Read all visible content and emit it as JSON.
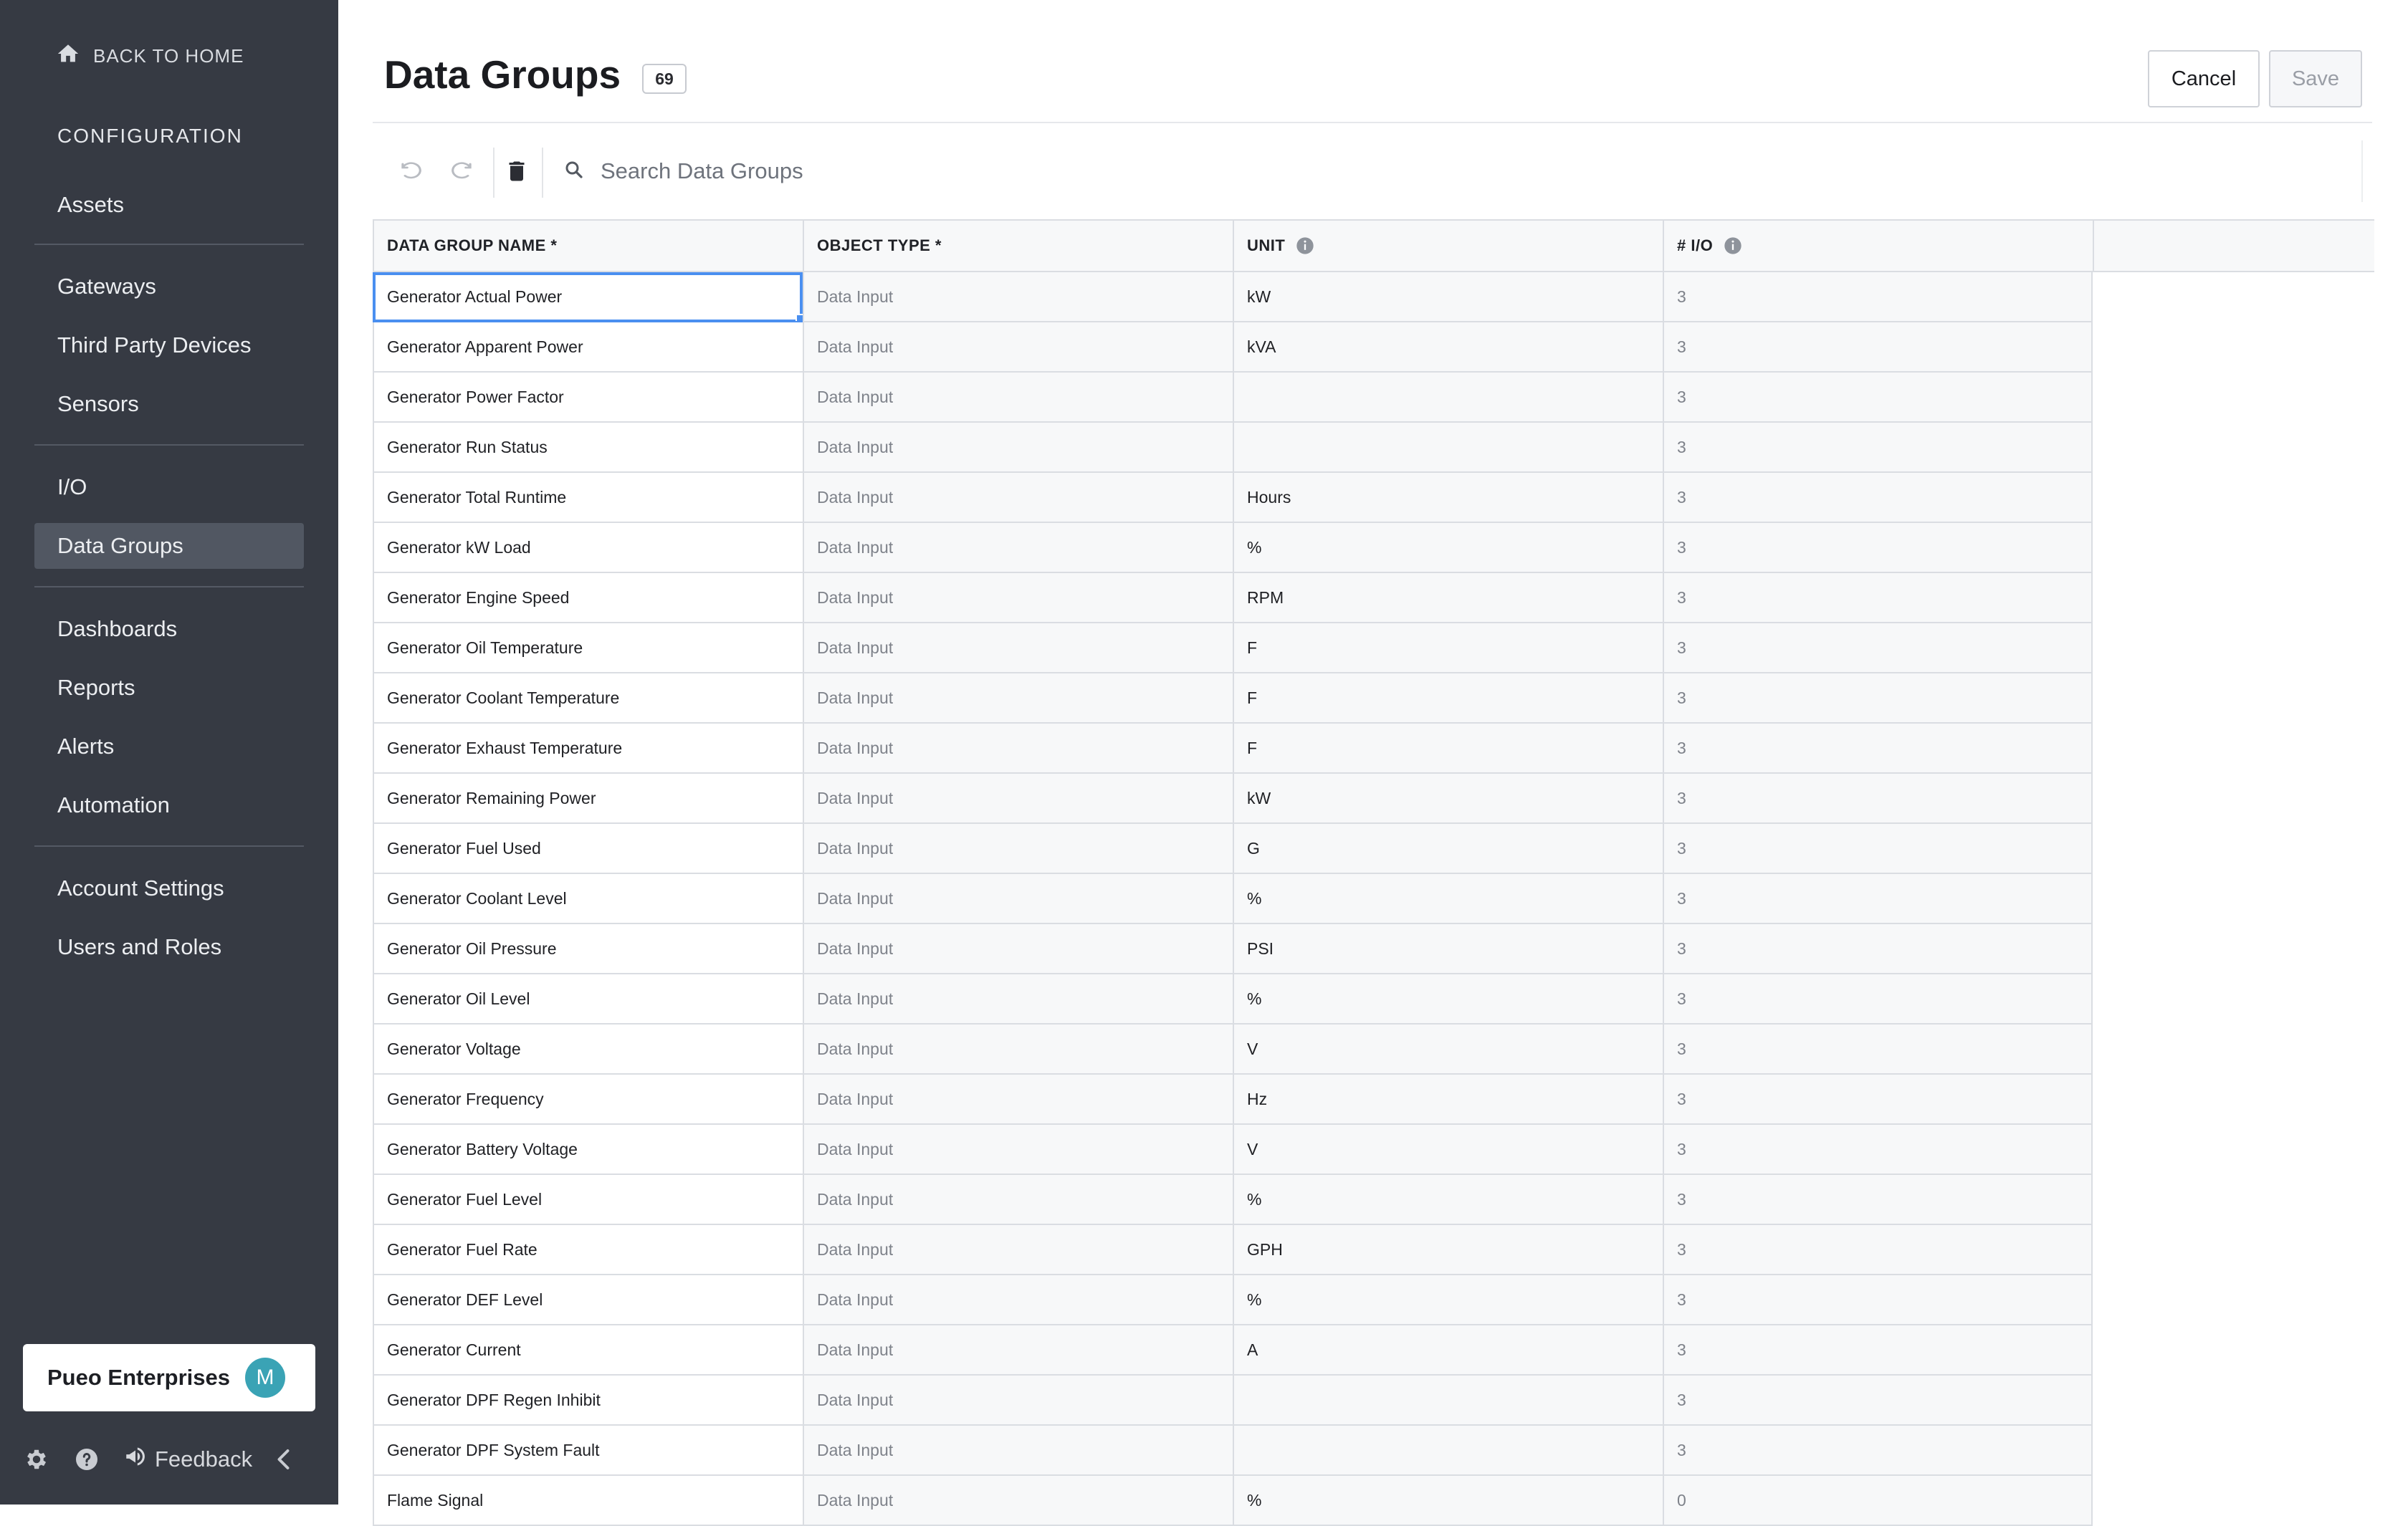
{
  "sidebar": {
    "back_label": "BACK TO HOME",
    "section_title": "CONFIGURATION",
    "groups": [
      [
        {
          "label": "Assets"
        }
      ],
      [
        {
          "label": "Gateways"
        },
        {
          "label": "Third Party Devices"
        },
        {
          "label": "Sensors"
        }
      ],
      [
        {
          "label": "I/O"
        },
        {
          "label": "Data Groups",
          "active": true
        }
      ],
      [
        {
          "label": "Dashboards"
        },
        {
          "label": "Reports"
        },
        {
          "label": "Alerts"
        },
        {
          "label": "Automation"
        }
      ],
      [
        {
          "label": "Account Settings"
        },
        {
          "label": "Users and Roles"
        }
      ]
    ],
    "org_name": "Pueo Enterprises",
    "avatar_initial": "M",
    "feedback_label": "Feedback"
  },
  "header": {
    "title": "Data Groups",
    "count": "69",
    "cancel_label": "Cancel",
    "save_label": "Save"
  },
  "toolbar": {
    "search_placeholder": "Search Data Groups"
  },
  "table": {
    "columns": [
      {
        "label": "DATA GROUP NAME *",
        "info": false
      },
      {
        "label": "OBJECT TYPE *",
        "info": false
      },
      {
        "label": "UNIT",
        "info": true
      },
      {
        "label": "# I/O",
        "info": true
      }
    ],
    "rows": [
      {
        "name": "Generator Actual Power",
        "type": "Data Input",
        "unit": "kW",
        "io": "3",
        "selected": true
      },
      {
        "name": "Generator Apparent Power",
        "type": "Data Input",
        "unit": "kVA",
        "io": "3"
      },
      {
        "name": "Generator Power Factor",
        "type": "Data Input",
        "unit": "",
        "io": "3"
      },
      {
        "name": "Generator Run Status",
        "type": "Data Input",
        "unit": "",
        "io": "3"
      },
      {
        "name": "Generator Total Runtime",
        "type": "Data Input",
        "unit": "Hours",
        "io": "3"
      },
      {
        "name": "Generator kW Load",
        "type": "Data Input",
        "unit": "%",
        "io": "3"
      },
      {
        "name": "Generator Engine Speed",
        "type": "Data Input",
        "unit": "RPM",
        "io": "3"
      },
      {
        "name": "Generator Oil Temperature",
        "type": "Data Input",
        "unit": "F",
        "io": "3"
      },
      {
        "name": "Generator Coolant Temperature",
        "type": "Data Input",
        "unit": "F",
        "io": "3"
      },
      {
        "name": "Generator Exhaust Temperature",
        "type": "Data Input",
        "unit": "F",
        "io": "3"
      },
      {
        "name": "Generator Remaining Power",
        "type": "Data Input",
        "unit": "kW",
        "io": "3"
      },
      {
        "name": "Generator Fuel Used",
        "type": "Data Input",
        "unit": "G",
        "io": "3"
      },
      {
        "name": "Generator Coolant Level",
        "type": "Data Input",
        "unit": "%",
        "io": "3"
      },
      {
        "name": "Generator Oil Pressure",
        "type": "Data Input",
        "unit": "PSI",
        "io": "3"
      },
      {
        "name": "Generator Oil Level",
        "type": "Data Input",
        "unit": "%",
        "io": "3"
      },
      {
        "name": "Generator Voltage",
        "type": "Data Input",
        "unit": "V",
        "io": "3"
      },
      {
        "name": "Generator Frequency",
        "type": "Data Input",
        "unit": "Hz",
        "io": "3"
      },
      {
        "name": "Generator Battery Voltage",
        "type": "Data Input",
        "unit": "V",
        "io": "3"
      },
      {
        "name": "Generator Fuel Level",
        "type": "Data Input",
        "unit": "%",
        "io": "3"
      },
      {
        "name": "Generator Fuel Rate",
        "type": "Data Input",
        "unit": "GPH",
        "io": "3"
      },
      {
        "name": "Generator DEF Level",
        "type": "Data Input",
        "unit": "%",
        "io": "3"
      },
      {
        "name": "Generator Current",
        "type": "Data Input",
        "unit": "A",
        "io": "3"
      },
      {
        "name": "Generator DPF Regen Inhibit",
        "type": "Data Input",
        "unit": "",
        "io": "3"
      },
      {
        "name": "Generator DPF System Fault",
        "type": "Data Input",
        "unit": "",
        "io": "3"
      },
      {
        "name": "Flame Signal",
        "type": "Data Input",
        "unit": "%",
        "io": "0"
      }
    ]
  },
  "colors": {
    "sidebar_bg": "#363a43",
    "active_item_bg": "#515762",
    "selection_blue": "#4a8ff0",
    "avatar_bg": "#3aa3b5"
  }
}
